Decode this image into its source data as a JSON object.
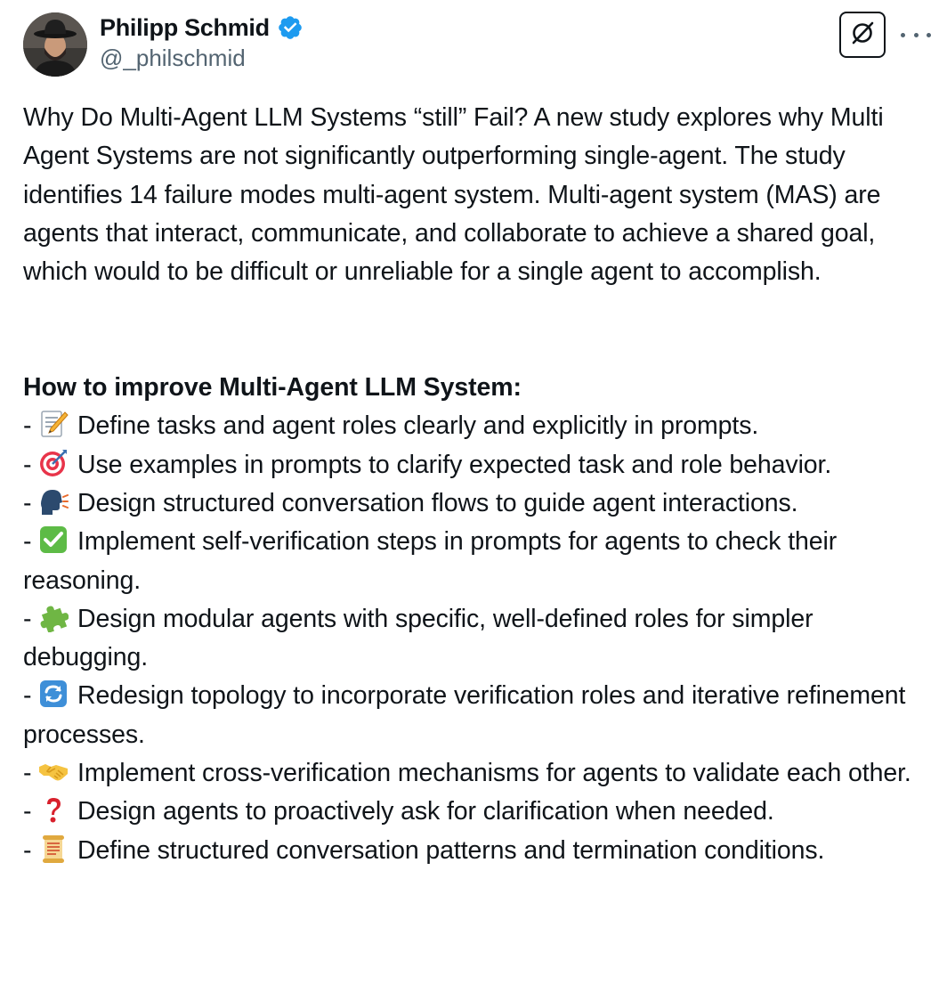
{
  "author": {
    "display_name": "Philipp Schmid",
    "handle": "@_philschmid",
    "verified": true
  },
  "header_actions": {
    "grok_icon": "grok-icon",
    "more_icon": "more-icon"
  },
  "tweet": {
    "intro": "Why Do Multi-Agent LLM Systems “still” Fail? A new study explores why Multi Agent Systems are not significantly outperforming single-agent. The study identifies 14 failure modes multi-agent system. Multi-agent system (MAS) are agents that interact, communicate, and collaborate to achieve a shared goal, which would to be difficult or unreliable for a single agent to accomplish.",
    "heading": "How to improve Multi-Agent LLM System:",
    "bullets": [
      {
        "prefix": "- ",
        "icon": "memo-icon",
        "text": "Define tasks and agent roles clearly and explicitly in prompts."
      },
      {
        "prefix": "- ",
        "icon": "target-icon",
        "text": "Use examples in prompts to clarify expected task and role behavior."
      },
      {
        "prefix": "- ",
        "icon": "speaking-head-icon",
        "text": "Design structured conversation flows to guide agent interactions."
      },
      {
        "prefix": "- ",
        "icon": "check-mark-icon",
        "text": "Implement self-verification steps in prompts for agents to check their reasoning."
      },
      {
        "prefix": "- ",
        "icon": "puzzle-piece-icon",
        "text": "Design modular agents with specific, well-defined roles for simpler debugging."
      },
      {
        "prefix": "- ",
        "icon": "refresh-arrows-icon",
        "text": "Redesign topology to incorporate verification roles and iterative refinement processes."
      },
      {
        "prefix": "- ",
        "icon": "handshake-icon",
        "text": "Implement cross-verification mechanisms for agents to validate each other."
      },
      {
        "prefix": "- ",
        "icon": "question-mark-icon",
        "text": "Design agents to proactively ask for clarification when needed."
      },
      {
        "prefix": "- ",
        "icon": "scroll-icon",
        "text": "Define structured conversation patterns and termination conditions."
      }
    ]
  },
  "colors": {
    "text_primary": "#0f1419",
    "text_secondary": "#536471",
    "verified_blue": "#1d9bf0"
  }
}
